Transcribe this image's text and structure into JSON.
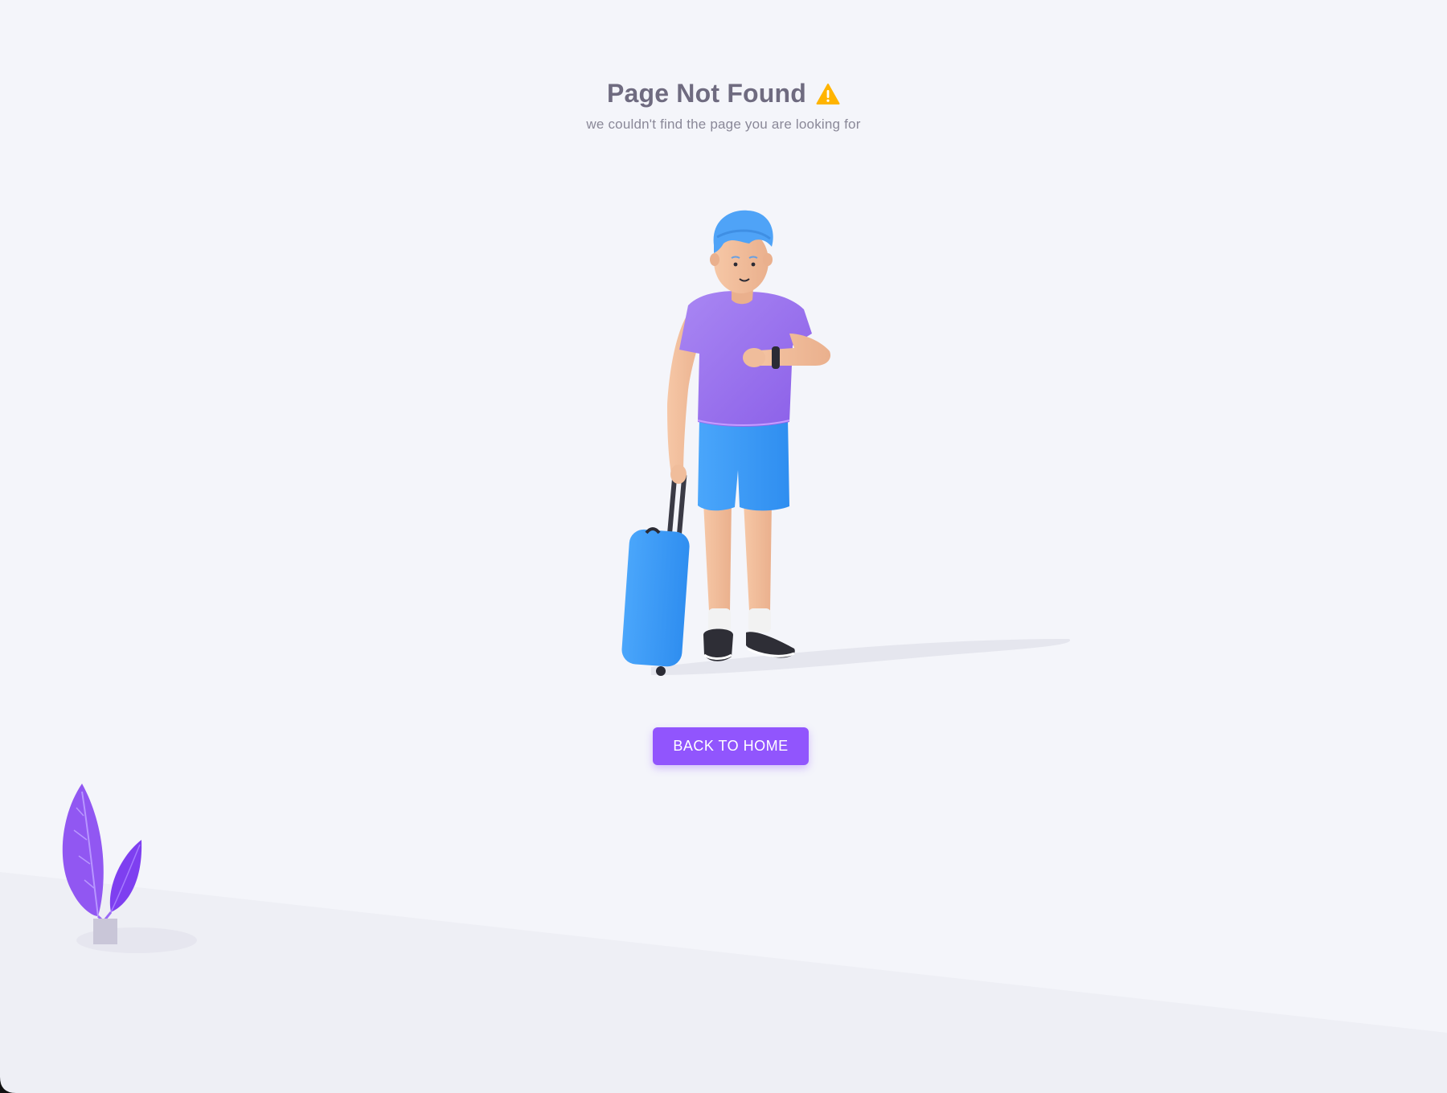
{
  "page": {
    "title": "Page Not Found",
    "subtitle": "we couldn't find the page you are looking for",
    "title_icon": "warning-icon"
  },
  "illustration": {
    "subject": "traveler-with-suitcase-illustration",
    "decoration": "plant-illustration"
  },
  "actions": {
    "back_to_home_label": "BACK TO HOME"
  },
  "colors": {
    "background": "#f4f5fa",
    "primary": "#9155fd",
    "title_text": "#6f6b80",
    "subtitle_text": "#8a8898",
    "warning": "#ffb400"
  }
}
